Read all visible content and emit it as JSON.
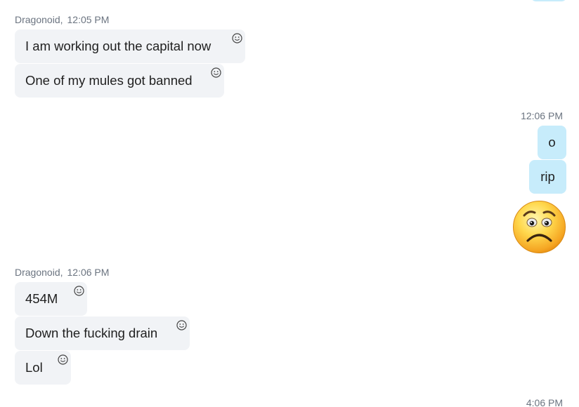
{
  "messages": {
    "group1": {
      "sender": "Dragonoid,",
      "time": "12:05 PM",
      "items": [
        "I am working out the capital now",
        "One of my mules got banned"
      ]
    },
    "group2": {
      "time": "12:06 PM",
      "items": [
        "o",
        "rip"
      ],
      "emoji": "worried-face-emoji"
    },
    "group3": {
      "sender": "Dragonoid,",
      "time": "12:06 PM",
      "items": [
        "454M",
        "Down the fucking drain",
        "Lol"
      ]
    },
    "footer_time": "4:06 PM"
  },
  "icons": {
    "reaction": "smiley-reaction-icon"
  },
  "colors": {
    "incoming_bubble": "#f1f3f6",
    "outgoing_bubble": "#c7ecfb",
    "meta_text": "#6b7480"
  }
}
